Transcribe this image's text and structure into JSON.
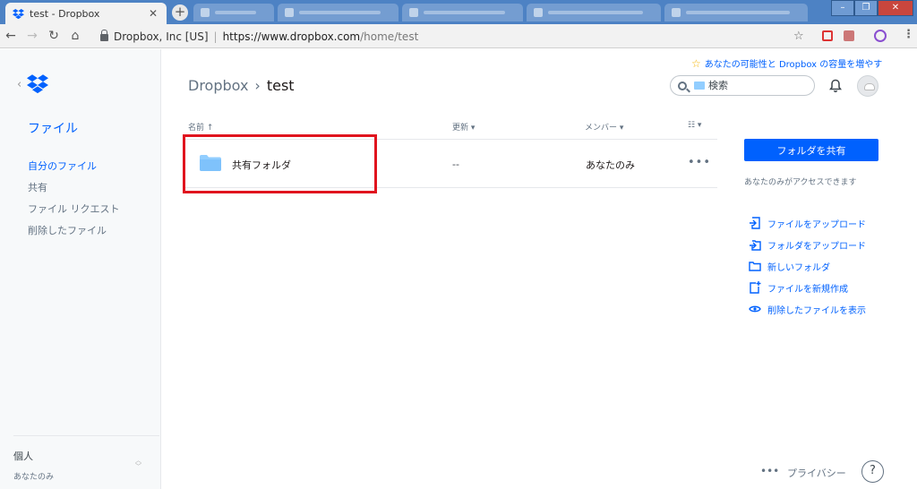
{
  "browser": {
    "tab_title": "test - Dropbox",
    "new_tab_symbol": "+",
    "omnibox": {
      "org": "Dropbox, Inc [US]",
      "url_host": "https://www.dropbox.com",
      "url_path": "/home/test"
    }
  },
  "sidebar": {
    "title": "ファイル",
    "items": [
      {
        "label": "自分のファイル",
        "active": true
      },
      {
        "label": "共有",
        "active": false
      },
      {
        "label": "ファイル リクエスト",
        "active": false
      },
      {
        "label": "削除したファイル",
        "active": false
      }
    ],
    "account": {
      "name": "個人",
      "plan": "あなたのみ"
    }
  },
  "header": {
    "upgrade_text": "あなたの可能性と Dropbox の容量を増やす",
    "breadcrumb": {
      "root": "Dropbox",
      "separator": "›",
      "current": "test"
    },
    "search_placeholder": "検索"
  },
  "table": {
    "columns": {
      "name": "名前 ↑",
      "modified": "更新 ▾",
      "members": "メンバー ▾",
      "view": "☷ ▾"
    },
    "rows": [
      {
        "name": "共有フォルダ",
        "modified": "--",
        "members": "あなたのみ",
        "more": "•••"
      }
    ]
  },
  "right_panel": {
    "share_button": "フォルダを共有",
    "access_text": "あなたのみがアクセスできます",
    "actions": [
      {
        "label": "ファイルをアップロード",
        "icon": "upload-file-icon"
      },
      {
        "label": "フォルダをアップロード",
        "icon": "upload-folder-icon"
      },
      {
        "label": "新しいフォルダ",
        "icon": "new-folder-icon"
      },
      {
        "label": "ファイルを新規作成",
        "icon": "new-file-icon"
      },
      {
        "label": "削除したファイルを表示",
        "icon": "eye-icon"
      }
    ]
  },
  "footer": {
    "more": "•••",
    "privacy": "プライバシー",
    "help": "?"
  },
  "colors": {
    "accent": "#0061fe",
    "highlight": "#e0141e",
    "folder": "#92ceff"
  }
}
